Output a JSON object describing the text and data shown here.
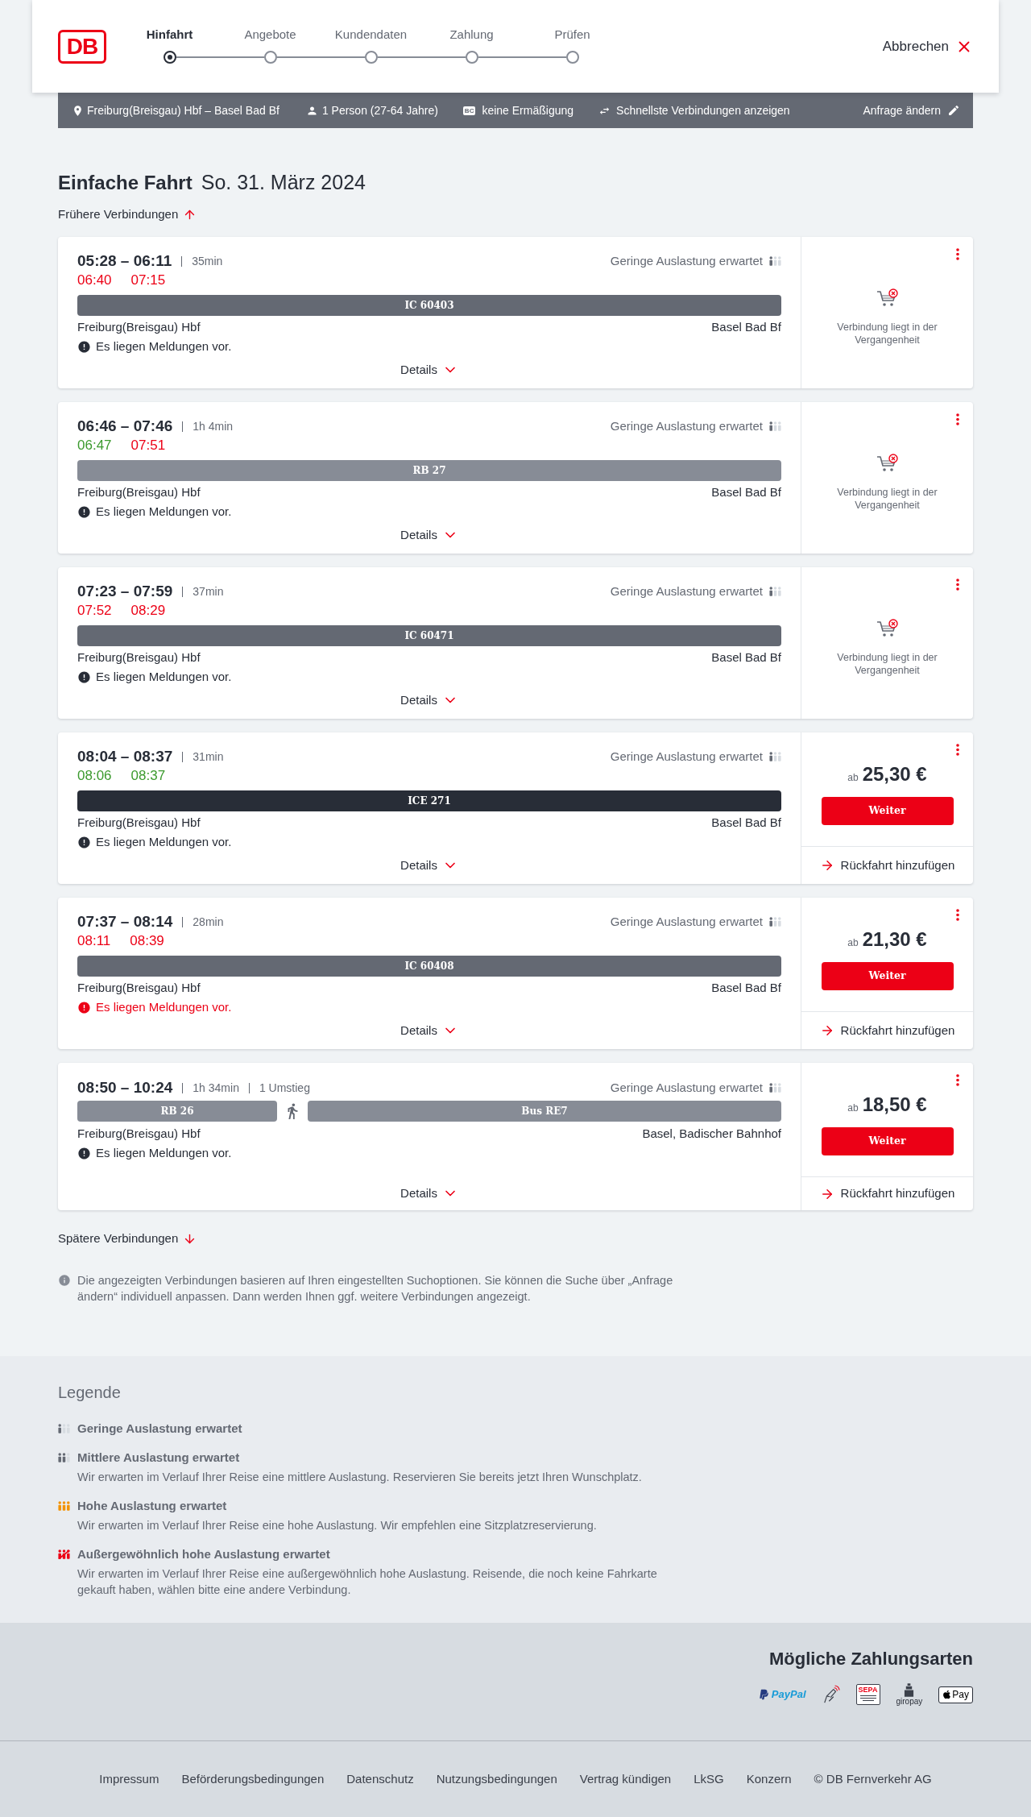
{
  "header": {
    "logo": "DB",
    "steps": [
      {
        "label": "Hinfahrt",
        "selected": true
      },
      {
        "label": "Angebote",
        "selected": false
      },
      {
        "label": "Kundendaten",
        "selected": false
      },
      {
        "label": "Zahlung",
        "selected": false
      },
      {
        "label": "Prüfen",
        "selected": false
      }
    ],
    "cancel": "Abbrechen"
  },
  "search_summary": {
    "route": "Freiburg(Breisgau) Hbf – Basel Bad Bf",
    "travellers": "1 Person (27-64 Jahre)",
    "discount_badge": "BC",
    "discount": "keine Ermäßigung",
    "sorting": "Schnellste Verbindungen anzeigen",
    "edit": "Anfrage ändern"
  },
  "heading": {
    "title": "Einfache Fahrt",
    "date": "So. 31. März 2024"
  },
  "earlier": "Frühere Verbindungen",
  "connections": [
    {
      "times": "05:28 – 06:11",
      "duration": "35min",
      "occupancy": {
        "label": "Geringe Auslastung erwartet",
        "kind": "low"
      },
      "realtime": [
        {
          "time": "06:40",
          "delayed": true
        },
        {
          "time": "07:15",
          "delayed": true
        }
      ],
      "legs": [
        {
          "label": "IC 60403",
          "kind": "ic"
        }
      ],
      "from": "Freiburg(Breisgau) Hbf",
      "to": "Basel Bad Bf",
      "message": "Es liegen Meldungen vor.",
      "message_alert": false,
      "details": "Details",
      "offer": {
        "kind": "past",
        "text": "Verbindung liegt in der Vergangenheit"
      }
    },
    {
      "times": "06:46 – 07:46",
      "duration": "1h 4min",
      "occupancy": {
        "label": "Geringe Auslastung erwartet",
        "kind": "low"
      },
      "realtime": [
        {
          "time": "06:47",
          "delayed": false
        },
        {
          "time": "07:51",
          "delayed": true
        }
      ],
      "legs": [
        {
          "label": "RB 27",
          "kind": "regional"
        }
      ],
      "from": "Freiburg(Breisgau) Hbf",
      "to": "Basel Bad Bf",
      "message": "Es liegen Meldungen vor.",
      "message_alert": false,
      "details": "Details",
      "offer": {
        "kind": "past",
        "text": "Verbindung liegt in der Vergangenheit"
      }
    },
    {
      "times": "07:23 – 07:59",
      "duration": "37min",
      "occupancy": {
        "label": "Geringe Auslastung erwartet",
        "kind": "low"
      },
      "realtime": [
        {
          "time": "07:52",
          "delayed": true
        },
        {
          "time": "08:29",
          "delayed": true
        }
      ],
      "legs": [
        {
          "label": "IC 60471",
          "kind": "ic"
        }
      ],
      "from": "Freiburg(Breisgau) Hbf",
      "to": "Basel Bad Bf",
      "message": "Es liegen Meldungen vor.",
      "message_alert": false,
      "details": "Details",
      "offer": {
        "kind": "past",
        "text": "Verbindung liegt in der Vergangenheit"
      }
    },
    {
      "times": "08:04 – 08:37",
      "duration": "31min",
      "occupancy": {
        "label": "Geringe Auslastung erwartet",
        "kind": "low"
      },
      "realtime": [
        {
          "time": "08:06",
          "delayed": false
        },
        {
          "time": "08:37",
          "delayed": false
        }
      ],
      "legs": [
        {
          "label": "ICE 271",
          "kind": "ice"
        }
      ],
      "from": "Freiburg(Breisgau) Hbf",
      "to": "Basel Bad Bf",
      "message": "Es liegen Meldungen vor.",
      "message_alert": false,
      "details": "Details",
      "offer": {
        "kind": "price",
        "prefix": "ab",
        "price": "25,30 €",
        "button": "Weiter",
        "return_trip": "Rückfahrt hinzufügen"
      }
    },
    {
      "times": "07:37 – 08:14",
      "duration": "28min",
      "occupancy": {
        "label": "Geringe Auslastung erwartet",
        "kind": "low"
      },
      "realtime": [
        {
          "time": "08:11",
          "delayed": true
        },
        {
          "time": "08:39",
          "delayed": true
        }
      ],
      "legs": [
        {
          "label": "IC 60408",
          "kind": "ic"
        }
      ],
      "from": "Freiburg(Breisgau) Hbf",
      "to": "Basel Bad Bf",
      "message": "Es liegen Meldungen vor.",
      "message_alert": true,
      "details": "Details",
      "offer": {
        "kind": "price",
        "prefix": "ab",
        "price": "21,30 €",
        "button": "Weiter",
        "return_trip": "Rückfahrt hinzufügen"
      }
    },
    {
      "times": "08:50 – 10:24",
      "duration": "1h 34min",
      "transfers": "1 Umstieg",
      "occupancy": {
        "label": "Geringe Auslastung erwartet",
        "kind": "low"
      },
      "legs": [
        {
          "label": "RB 26",
          "kind": "regional"
        },
        {
          "kind": "walk"
        },
        {
          "label": "Bus RE7",
          "kind": "bus"
        }
      ],
      "from": "Freiburg(Breisgau) Hbf",
      "to": "Basel, Badischer Bahnhof",
      "message": "Es liegen Meldungen vor.",
      "message_alert": false,
      "details": "Details",
      "offer": {
        "kind": "price",
        "prefix": "ab",
        "price": "18,50 €",
        "button": "Weiter",
        "return_trip": "Rückfahrt hinzufügen"
      }
    }
  ],
  "later": "Spätere Verbindungen",
  "info": "Die angezeigten Verbindungen basieren auf Ihren eingestellten Suchoptionen. Sie können die Suche über „Anfrage ändern“ individuell anpassen. Dann werden Ihnen ggf. weitere Verbindungen angezeigt.",
  "legend": {
    "title": "Legende",
    "items": [
      {
        "kind": "low",
        "label": "Geringe Auslastung erwartet"
      },
      {
        "kind": "medium",
        "label": "Mittlere Auslastung erwartet",
        "description": "Wir erwarten im Verlauf Ihrer Reise eine mittlere Auslastung. Reservieren Sie bereits jetzt Ihren Wunschplatz."
      },
      {
        "kind": "high",
        "label": "Hohe Auslastung erwartet",
        "description": "Wir erwarten im Verlauf Ihrer Reise eine hohe Auslastung. Wir empfehlen eine Sitzplatzreservierung."
      },
      {
        "kind": "exceptional",
        "label": "Außergewöhnlich hohe Auslastung erwartet",
        "description": "Wir erwarten im Verlauf Ihrer Reise eine außergewöhnlich hohe Auslastung. Reisende, die noch keine Fahrkarte gekauft haben, wählen bitte eine andere Verbindung."
      }
    ]
  },
  "payment": {
    "title": "Mögliche Zahlungsarten",
    "methods": [
      {
        "kind": "paypal",
        "label": "PayPal"
      },
      {
        "kind": "contactless"
      },
      {
        "kind": "sepa",
        "label": "SEPA"
      },
      {
        "kind": "giropay",
        "label": "giropay"
      },
      {
        "kind": "applepay",
        "label": "Pay"
      }
    ]
  },
  "footer_links": [
    "Impressum",
    "Beförderungsbedingungen",
    "Datenschutz",
    "Nutzungsbedingungen",
    "Vertrag kündigen",
    "LkSG",
    "Konzern",
    "© DB Fernverkehr AG"
  ]
}
